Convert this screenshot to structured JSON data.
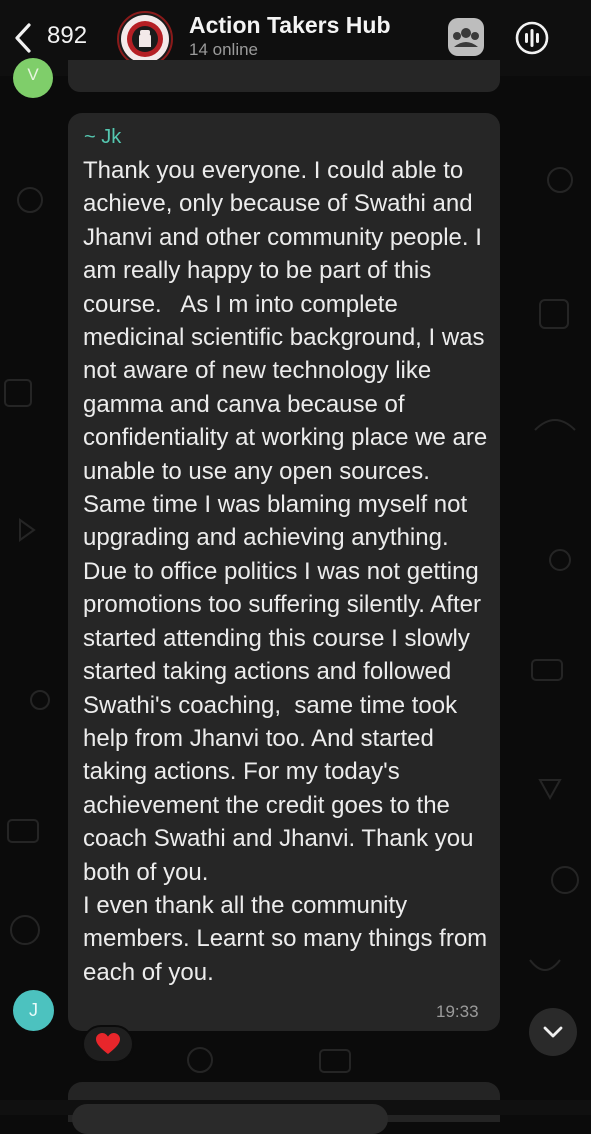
{
  "header": {
    "back_count": "892",
    "title": "Action Takers Hub",
    "subtitle": "14 online",
    "avatar_logo_text": "ACTION TAKERS"
  },
  "previous_message": {
    "avatar_initial": "V"
  },
  "message": {
    "sender": "~ Jk",
    "text": "Thank you everyone. I could able to achieve, only because of Swathi and Jhanvi and other community people. I am really happy to be part of this course.   As I m into complete medicinal scientific background, I was not aware of new technology like gamma and canva because of confidentiality at working place we are unable to use any open sources. Same time I was blaming myself not upgrading and achieving anything. Due to office politics I was not getting promotions too suffering silently. After started attending this course I slowly started taking actions and followed Swathi's coaching,  same time took help from Jhanvi too. And started taking actions. For my today's achievement the credit goes to the coach Swathi and Jhanvi. Thank you both of you.\nI even thank all the community members. Learnt so many things from each of you.",
    "time": "19:33",
    "avatar_initial": "J",
    "reaction": "❤️"
  },
  "icons": {
    "back": "chevron-left-icon",
    "community": "community-icon",
    "voice_chat": "voice-chat-icon",
    "scroll_down": "chevron-down-icon",
    "reaction": "heart-icon"
  },
  "colors": {
    "background": "#0b0b0b",
    "bubble": "#262626",
    "sender_name": "#55c7b0",
    "avatar_v": "#7fce6a",
    "avatar_j": "#4cc2bf"
  }
}
